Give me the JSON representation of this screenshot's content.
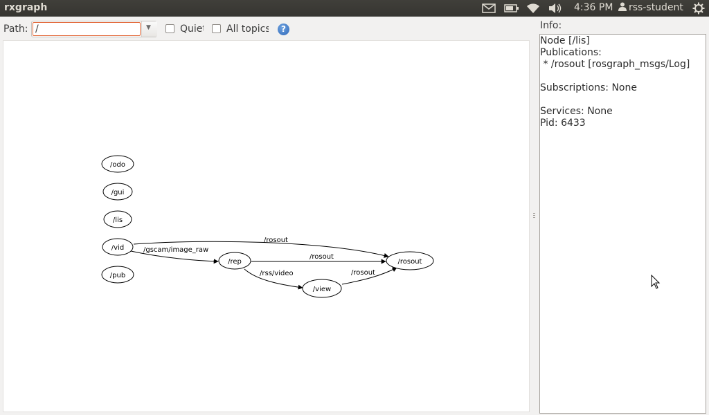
{
  "app": {
    "title": "rxgraph"
  },
  "system_tray": {
    "clock": "4:36 PM",
    "user": "rss-student",
    "icons": [
      "mail-icon",
      "battery-icon",
      "wifi-icon",
      "volume-icon",
      "user-icon",
      "power-icon"
    ]
  },
  "toolbar": {
    "path_label": "Path:",
    "path_value": "/",
    "quiet_label": "Quiet",
    "quiet_checked": false,
    "all_topics_label": "All topics",
    "all_topics_checked": false,
    "help_icon": "help-icon"
  },
  "graph": {
    "nodes": [
      "/odo",
      "/gui",
      "/lis",
      "/vid",
      "/pub",
      "/rep",
      "/rosout",
      "/view"
    ],
    "edges": [
      {
        "from": "/vid",
        "to": "/rosout",
        "label": "/rosout"
      },
      {
        "from": "/vid",
        "to": "/rep",
        "label": "/gscam/image_raw"
      },
      {
        "from": "/rep",
        "to": "/rosout",
        "label": "/rosout"
      },
      {
        "from": "/rep",
        "to": "/view",
        "label": "/rss/video"
      },
      {
        "from": "/view",
        "to": "/rosout",
        "label": "/rosout"
      }
    ]
  },
  "info": {
    "label": "Info:",
    "lines": [
      "Node [/lis]",
      "Publications:",
      " * /rosout [rosgraph_msgs/Log]",
      "",
      "Subscriptions: None",
      "",
      "Services: None",
      "Pid: 6433"
    ]
  }
}
